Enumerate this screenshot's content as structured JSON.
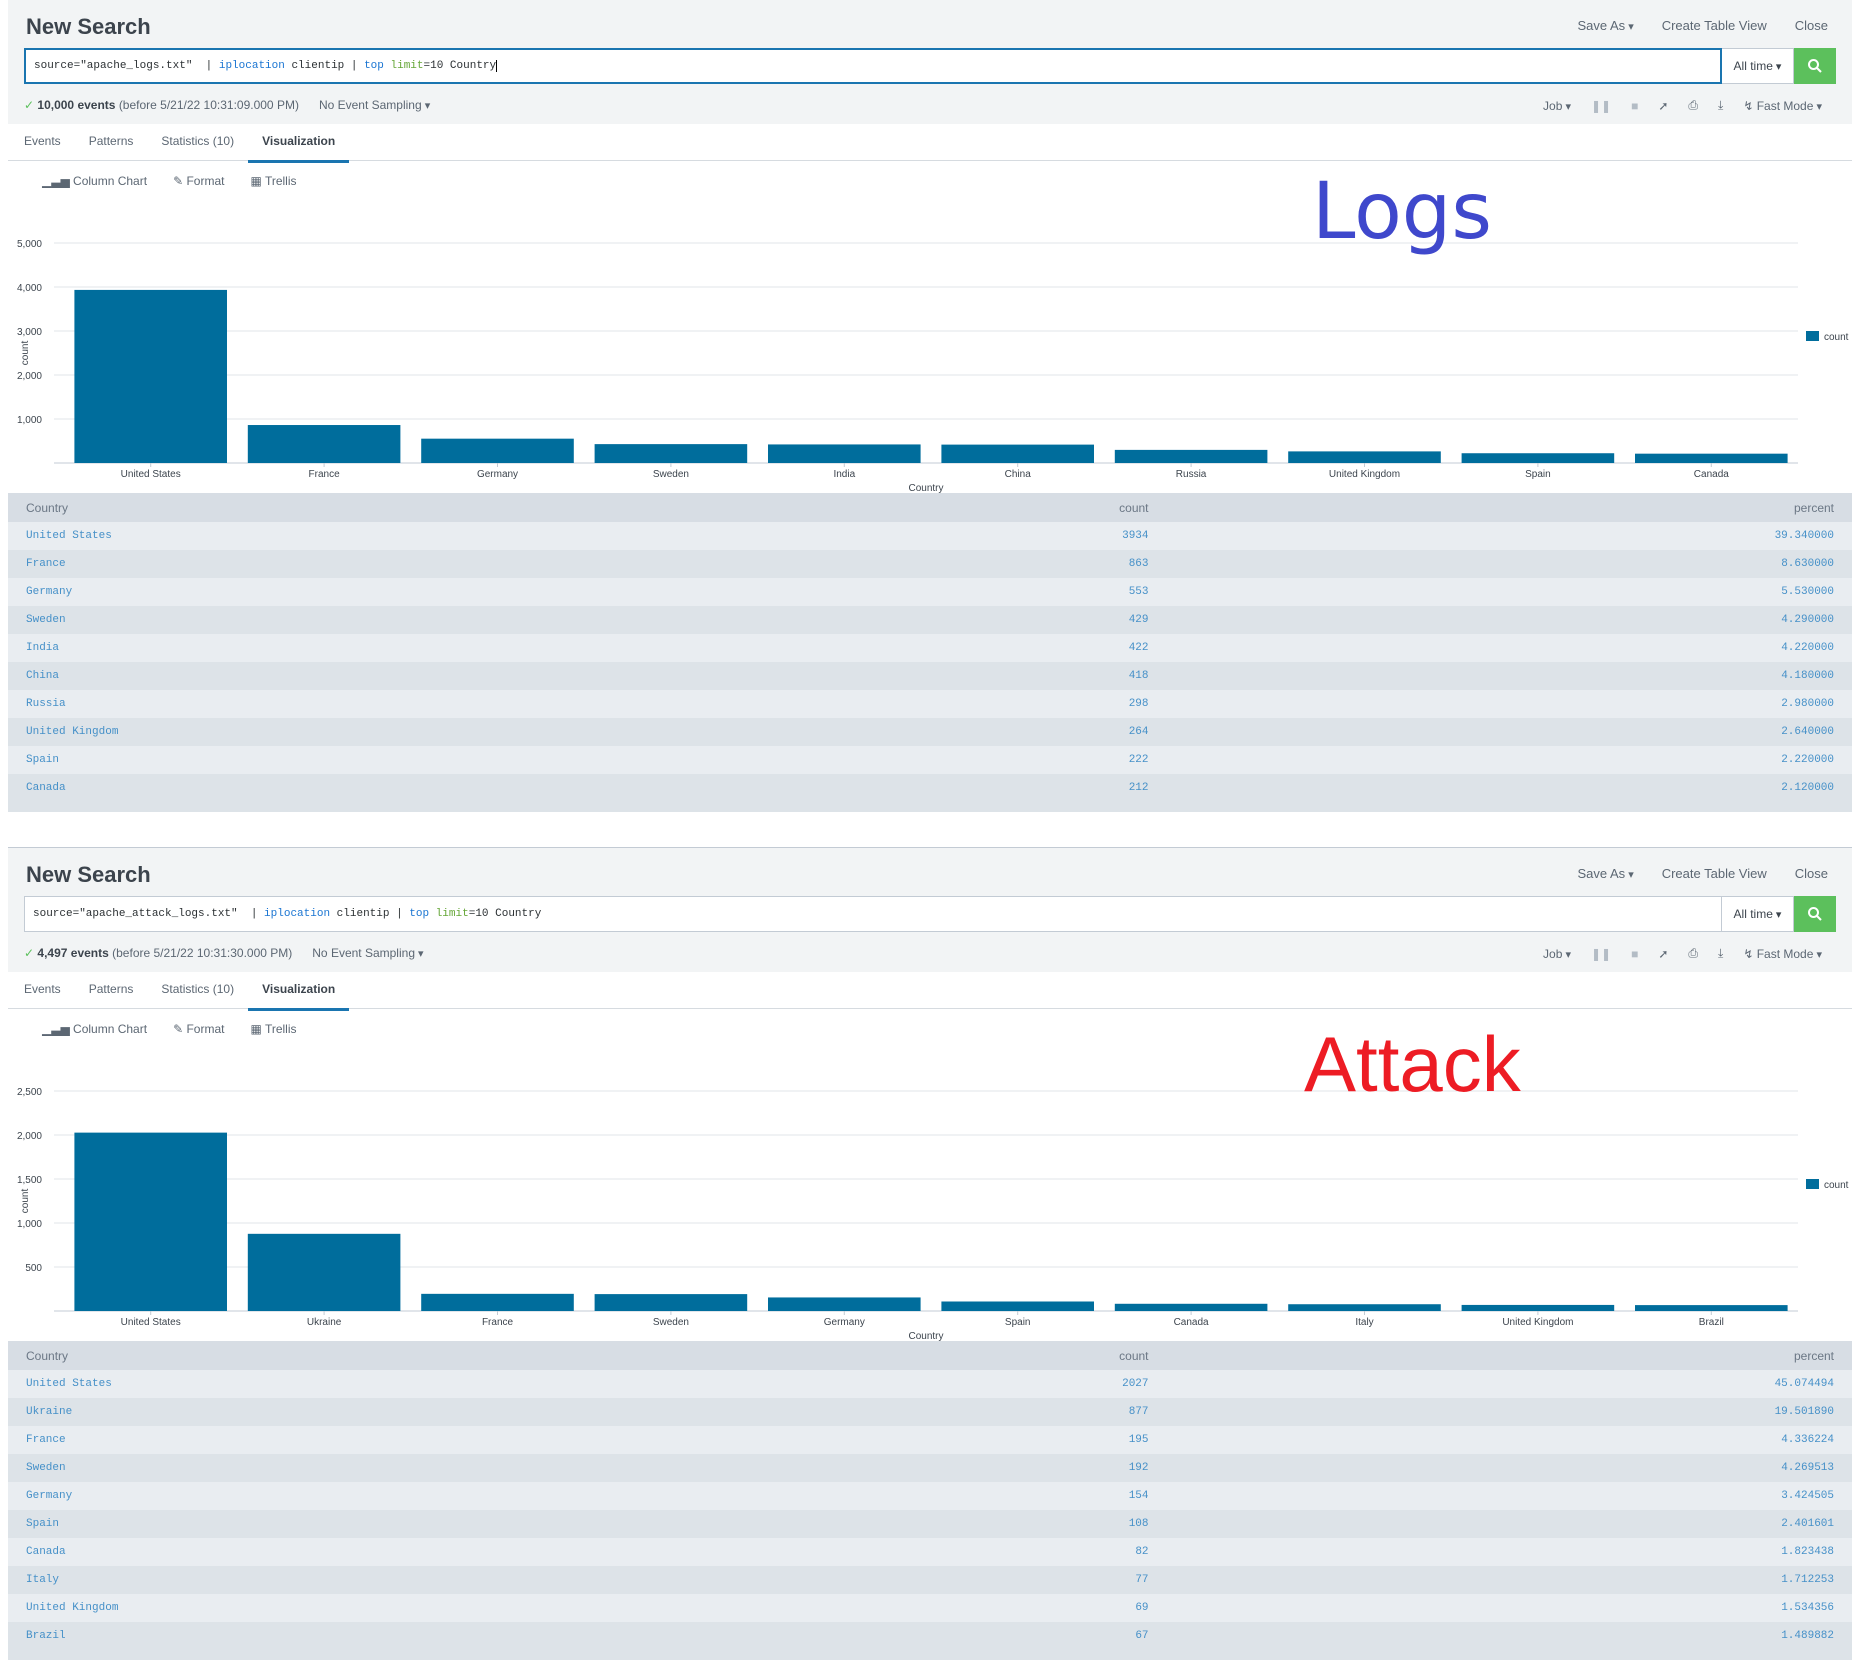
{
  "panels": [
    {
      "title": "New Search",
      "actions": {
        "save_as": "Save As",
        "create_table": "Create Table View",
        "close": "Close"
      },
      "query": {
        "source": "source=\"apache_logs.txt\"",
        "pipe1": "  | ",
        "cmd1": "iplocation",
        "arg1": " clientip ",
        "pipe2": "| ",
        "cmd2": "top",
        "sp": " ",
        "opt": "limit",
        "optval": "=10 Country"
      },
      "time_range": "All time",
      "status": {
        "check": "✓",
        "events": "10,000 events",
        "before": "(before 5/21/22 10:31:09.000 PM)",
        "sampling": "No Event Sampling"
      },
      "controls": {
        "job": "Job",
        "mode": "Fast Mode"
      },
      "tabs": [
        "Events",
        "Patterns",
        "Statistics (10)",
        "Visualization"
      ],
      "viz_toolbar": {
        "chart_type": "Column Chart",
        "format": "Format",
        "trellis": "Trellis"
      },
      "overlay_label": "Logs",
      "table": {
        "headers": [
          "Country",
          "count",
          "percent"
        ],
        "rows": [
          [
            "United States",
            "3934",
            "39.340000"
          ],
          [
            "France",
            "863",
            "8.630000"
          ],
          [
            "Germany",
            "553",
            "5.530000"
          ],
          [
            "Sweden",
            "429",
            "4.290000"
          ],
          [
            "India",
            "422",
            "4.220000"
          ],
          [
            "China",
            "418",
            "4.180000"
          ],
          [
            "Russia",
            "298",
            "2.980000"
          ],
          [
            "United Kingdom",
            "264",
            "2.640000"
          ],
          [
            "Spain",
            "222",
            "2.220000"
          ],
          [
            "Canada",
            "212",
            "2.120000"
          ]
        ]
      }
    },
    {
      "title": "New Search",
      "actions": {
        "save_as": "Save As",
        "create_table": "Create Table View",
        "close": "Close"
      },
      "query": {
        "source": "source=\"apache_attack_logs.txt\"",
        "pipe1": "  | ",
        "cmd1": "iplocation",
        "arg1": " clientip ",
        "pipe2": "| ",
        "cmd2": "top",
        "sp": " ",
        "opt": "limit",
        "optval": "=10 Country"
      },
      "time_range": "All time",
      "status": {
        "check": "✓",
        "events": "4,497 events",
        "before": "(before 5/21/22 10:31:30.000 PM)",
        "sampling": "No Event Sampling"
      },
      "controls": {
        "job": "Job",
        "mode": "Fast Mode"
      },
      "tabs": [
        "Events",
        "Patterns",
        "Statistics (10)",
        "Visualization"
      ],
      "viz_toolbar": {
        "chart_type": "Column Chart",
        "format": "Format",
        "trellis": "Trellis"
      },
      "overlay_label": "Attack",
      "table": {
        "headers": [
          "Country",
          "count",
          "percent"
        ],
        "rows": [
          [
            "United States",
            "2027",
            "45.074494"
          ],
          [
            "Ukraine",
            "877",
            "19.501890"
          ],
          [
            "France",
            "195",
            "4.336224"
          ],
          [
            "Sweden",
            "192",
            "4.269513"
          ],
          [
            "Germany",
            "154",
            "3.424505"
          ],
          [
            "Spain",
            "108",
            "2.401601"
          ],
          [
            "Canada",
            "82",
            "1.823438"
          ],
          [
            "Italy",
            "77",
            "1.712253"
          ],
          [
            "United Kingdom",
            "69",
            "1.534356"
          ],
          [
            "Brazil",
            "67",
            "1.489882"
          ]
        ]
      }
    }
  ],
  "chart_data": [
    {
      "type": "bar",
      "categories": [
        "United States",
        "France",
        "Germany",
        "Sweden",
        "India",
        "China",
        "Russia",
        "United Kingdom",
        "Spain",
        "Canada"
      ],
      "series": [
        {
          "name": "count",
          "values": [
            3934,
            863,
            553,
            429,
            422,
            418,
            298,
            264,
            222,
            212
          ]
        }
      ],
      "xlabel": "Country",
      "ylabel": "count",
      "ylim": [
        0,
        5000
      ],
      "yticks": [
        "1,000",
        "2,000",
        "3,000",
        "4,000",
        "5,000"
      ],
      "ytick_values": [
        1000,
        2000,
        3000,
        4000,
        5000
      ],
      "grid": true,
      "legend": "right",
      "color": "#006d9c"
    },
    {
      "type": "bar",
      "categories": [
        "United States",
        "Ukraine",
        "France",
        "Sweden",
        "Germany",
        "Spain",
        "Canada",
        "Italy",
        "United Kingdom",
        "Brazil"
      ],
      "series": [
        {
          "name": "count",
          "values": [
            2027,
            877,
            195,
            192,
            154,
            108,
            82,
            77,
            69,
            67
          ]
        }
      ],
      "xlabel": "Country",
      "ylabel": "count",
      "ylim": [
        0,
        2500
      ],
      "yticks": [
        "500",
        "1,000",
        "1,500",
        "2,000",
        "2,500"
      ],
      "ytick_values": [
        500,
        1000,
        1500,
        2000,
        2500
      ],
      "grid": true,
      "legend": "right",
      "color": "#006d9c"
    }
  ]
}
